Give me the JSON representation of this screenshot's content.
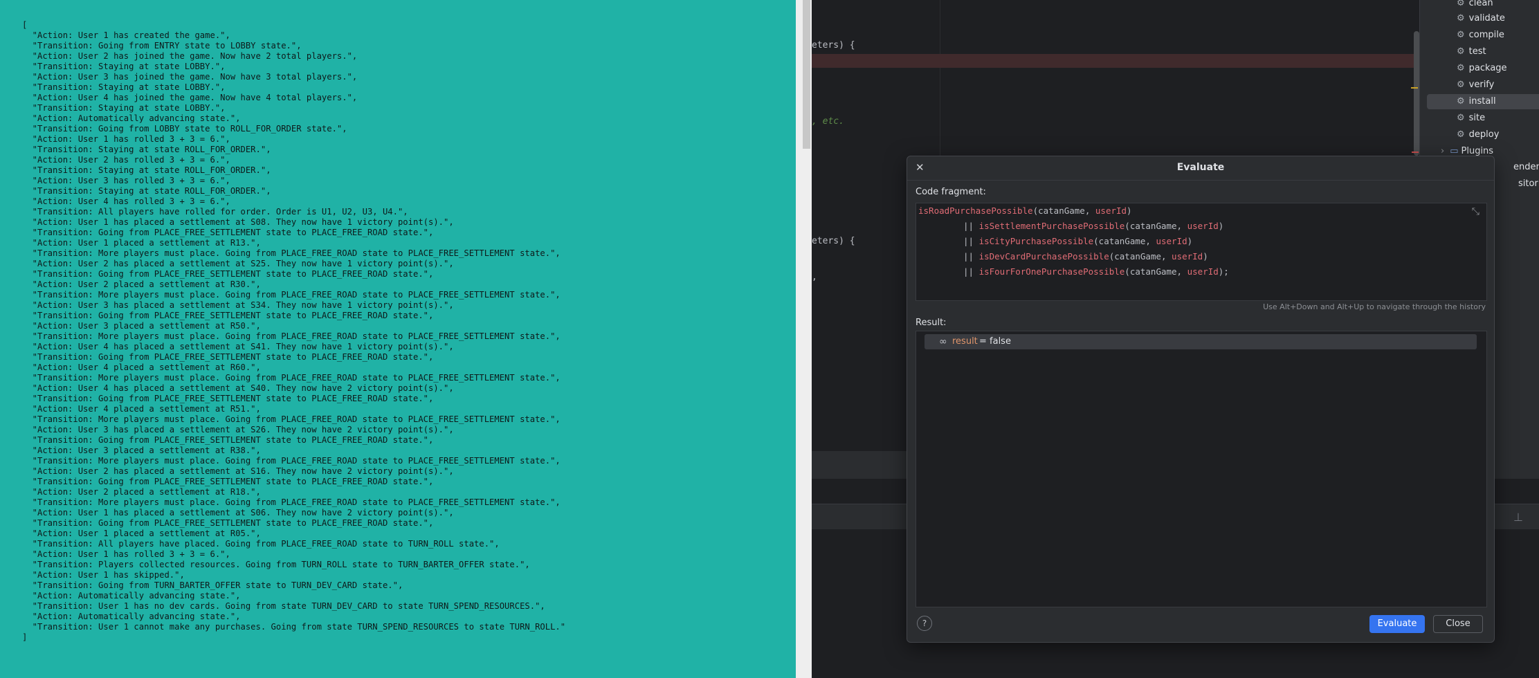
{
  "log": {
    "lines": [
      "[",
      "  \"Action: User 1 has created the game.\",",
      "  \"Transition: Going from ENTRY state to LOBBY state.\",",
      "  \"Action: User 2 has joined the game. Now have 2 total players.\",",
      "  \"Transition: Staying at state LOBBY.\",",
      "  \"Action: User 3 has joined the game. Now have 3 total players.\",",
      "  \"Transition: Staying at state LOBBY.\",",
      "  \"Action: User 4 has joined the game. Now have 4 total players.\",",
      "  \"Transition: Staying at state LOBBY.\",",
      "  \"Action: Automatically advancing state.\",",
      "  \"Transition: Going from LOBBY state to ROLL_FOR_ORDER state.\",",
      "  \"Action: User 1 has rolled 3 + 3 = 6.\",",
      "  \"Transition: Staying at state ROLL_FOR_ORDER.\",",
      "  \"Action: User 2 has rolled 3 + 3 = 6.\",",
      "  \"Transition: Staying at state ROLL_FOR_ORDER.\",",
      "  \"Action: User 3 has rolled 3 + 3 = 6.\",",
      "  \"Transition: Staying at state ROLL_FOR_ORDER.\",",
      "  \"Action: User 4 has rolled 3 + 3 = 6.\",",
      "  \"Transition: All players have rolled for order. Order is U1, U2, U3, U4.\",",
      "  \"Action: User 1 has placed a settlement at S08. They now have 1 victory point(s).\",",
      "  \"Transition: Going from PLACE_FREE_SETTLEMENT state to PLACE_FREE_ROAD state.\",",
      "  \"Action: User 1 placed a settlement at R13.\",",
      "  \"Transition: More players must place. Going from PLACE_FREE_ROAD state to PLACE_FREE_SETTLEMENT state.\",",
      "  \"Action: User 2 has placed a settlement at S25. They now have 1 victory point(s).\",",
      "  \"Transition: Going from PLACE_FREE_SETTLEMENT state to PLACE_FREE_ROAD state.\",",
      "  \"Action: User 2 placed a settlement at R30.\",",
      "  \"Transition: More players must place. Going from PLACE_FREE_ROAD state to PLACE_FREE_SETTLEMENT state.\",",
      "  \"Action: User 3 has placed a settlement at S34. They now have 1 victory point(s).\",",
      "  \"Transition: Going from PLACE_FREE_SETTLEMENT state to PLACE_FREE_ROAD state.\",",
      "  \"Action: User 3 placed a settlement at R50.\",",
      "  \"Transition: More players must place. Going from PLACE_FREE_ROAD state to PLACE_FREE_SETTLEMENT state.\",",
      "  \"Action: User 4 has placed a settlement at S41. They now have 1 victory point(s).\",",
      "  \"Transition: Going from PLACE_FREE_SETTLEMENT state to PLACE_FREE_ROAD state.\",",
      "  \"Action: User 4 placed a settlement at R60.\",",
      "  \"Transition: More players must place. Going from PLACE_FREE_ROAD state to PLACE_FREE_SETTLEMENT state.\",",
      "  \"Action: User 4 has placed a settlement at S40. They now have 2 victory point(s).\",",
      "  \"Transition: Going from PLACE_FREE_SETTLEMENT state to PLACE_FREE_ROAD state.\",",
      "  \"Action: User 4 placed a settlement at R51.\",",
      "  \"Transition: More players must place. Going from PLACE_FREE_ROAD state to PLACE_FREE_SETTLEMENT state.\",",
      "  \"Action: User 3 has placed a settlement at S26. They now have 2 victory point(s).\",",
      "  \"Transition: Going from PLACE_FREE_SETTLEMENT state to PLACE_FREE_ROAD state.\",",
      "  \"Action: User 3 placed a settlement at R38.\",",
      "  \"Transition: More players must place. Going from PLACE_FREE_ROAD state to PLACE_FREE_SETTLEMENT state.\",",
      "  \"Action: User 2 has placed a settlement at S16. They now have 2 victory point(s).\",",
      "  \"Transition: Going from PLACE_FREE_SETTLEMENT state to PLACE_FREE_ROAD state.\",",
      "  \"Action: User 2 placed a settlement at R18.\",",
      "  \"Transition: More players must place. Going from PLACE_FREE_ROAD state to PLACE_FREE_SETTLEMENT state.\",",
      "  \"Action: User 1 has placed a settlement at S06. They now have 2 victory point(s).\",",
      "  \"Transition: Going from PLACE_FREE_SETTLEMENT state to PLACE_FREE_ROAD state.\",",
      "  \"Action: User 1 placed a settlement at R05.\",",
      "  \"Transition: All players have placed. Going from PLACE_FREE_ROAD state to TURN_ROLL state.\",",
      "  \"Action: User 1 has rolled 3 + 3 = 6.\",",
      "  \"Transition: Players collected resources. Going from TURN_ROLL state to TURN_BARTER_OFFER state.\",",
      "  \"Action: User 1 has skipped.\",",
      "  \"Transition: Going from TURN_BARTER_OFFER state to TURN_DEV_CARD state.\",",
      "  \"Action: Automatically advancing state.\",",
      "  \"Transition: User 1 has no dev cards. Going from state TURN_DEV_CARD to state TURN_SPEND_RESOURCES.\",",
      "  \"Action: Automatically advancing state.\",",
      "  \"Transition: User 1 cannot make any purchases. Going from state TURN_SPEND_RESOURCES to state TURN_ROLL.\"",
      "]"
    ]
  },
  "editor": {
    "line1": "eters) {",
    "line2": ", etc.",
    "line3": "eters) {",
    "line4": ","
  },
  "maven": {
    "items": [
      "clean",
      "validate",
      "compile",
      "test",
      "package",
      "verify",
      "install",
      "site",
      "deploy"
    ],
    "selected": "install",
    "plugins": "Plugins",
    "dependencies_trunc": "endencies",
    "repositories_trunc": "sitories"
  },
  "dialog": {
    "title": "Evaluate",
    "code_label": "Code fragment:",
    "code": {
      "l1_fn": "isRoadPurchasePossible",
      "l1_a": "(catanGame, ",
      "l1_b": "userId",
      "l1_c": ")",
      "l2_op": "|| ",
      "l2_fn": "isSettlementPurchasePossible",
      "l2_a": "(catanGame, ",
      "l2_b": "userId",
      "l2_c": ")",
      "l3_op": "|| ",
      "l3_fn": "isCityPurchasePossible",
      "l3_a": "(catanGame, ",
      "l3_b": "userId",
      "l3_c": ")",
      "l4_op": "|| ",
      "l4_fn": "isDevCardPurchasePossible",
      "l4_a": "(catanGame, ",
      "l4_b": "userId",
      "l4_c": ")",
      "l5_op": "|| ",
      "l5_fn": "isFourForOnePurchasePossible",
      "l5_a": "(catanGame, ",
      "l5_b": "userId",
      "l5_c": ");"
    },
    "history_hint": "Use Alt+Down and Alt+Up to navigate through the history",
    "result_label": "Result:",
    "result_name": "result",
    "result_rest": "= false",
    "help_label": "?",
    "evaluate_label": "Evaluate",
    "close_label": "Close"
  }
}
